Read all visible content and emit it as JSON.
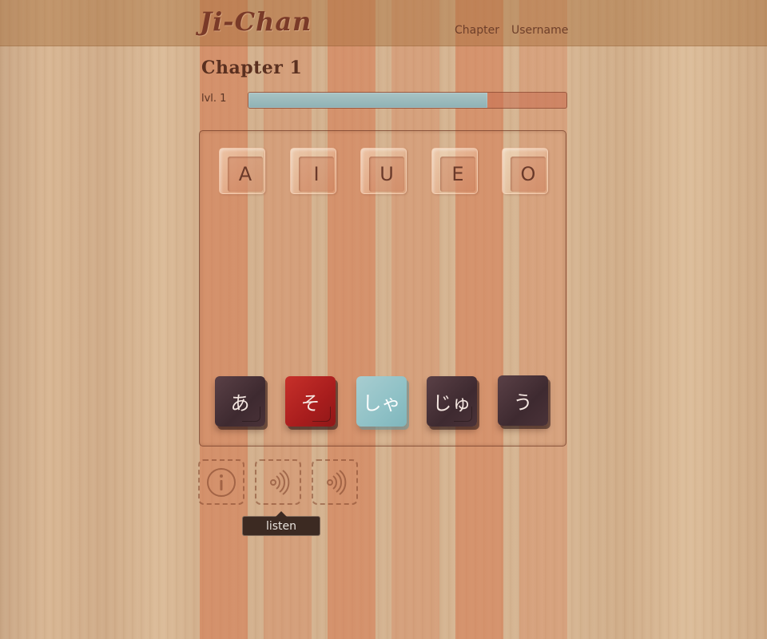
{
  "app": {
    "logo": "Ji-Chan"
  },
  "nav": {
    "chapter": "Chapter",
    "username": "Username"
  },
  "chapter": {
    "title": "Chapter 1"
  },
  "level": {
    "label": "lvl. 1",
    "progress_fraction": 0.75
  },
  "slots": [
    {
      "label": "A"
    },
    {
      "label": "I"
    },
    {
      "label": "U"
    },
    {
      "label": "E"
    },
    {
      "label": "O"
    }
  ],
  "tiles": [
    {
      "label": "あ",
      "style": "dark"
    },
    {
      "label": "そ",
      "style": "red"
    },
    {
      "label": "しゃ",
      "style": "cyan"
    },
    {
      "label": "じゅ",
      "style": "dark"
    },
    {
      "label": "う",
      "style": "dark"
    }
  ],
  "tools": {
    "info_icon": "info-icon",
    "listen_icon": "speaker-waves-icon",
    "listen2_icon": "speaker-waves-icon",
    "tooltip": "listen"
  },
  "colors": {
    "progress_fill": "#8fb2b5",
    "tile_dark": "#3e2a30",
    "tile_red": "#a81d1d",
    "tile_cyan": "#8fc1c6"
  }
}
